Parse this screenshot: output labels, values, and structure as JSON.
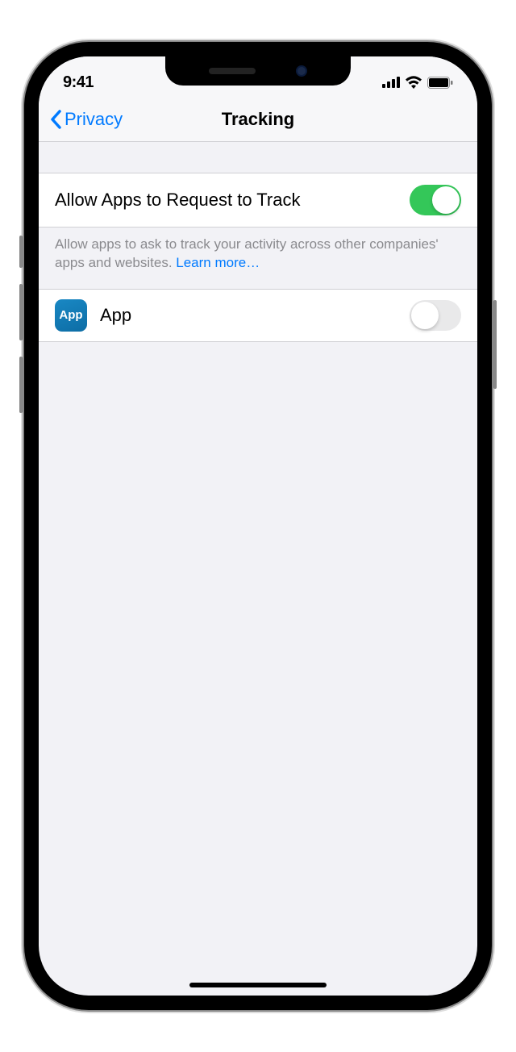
{
  "status": {
    "time": "9:41"
  },
  "nav": {
    "back_label": "Privacy",
    "title": "Tracking"
  },
  "settings": {
    "allow_request_label": "Allow Apps to Request to Track",
    "allow_request_on": true,
    "footer_text": "Allow apps to ask to track your activity across other companies' apps and websites. ",
    "footer_link": "Learn more…"
  },
  "apps": [
    {
      "icon_label": "App",
      "name": "App",
      "tracking_on": false
    }
  ]
}
